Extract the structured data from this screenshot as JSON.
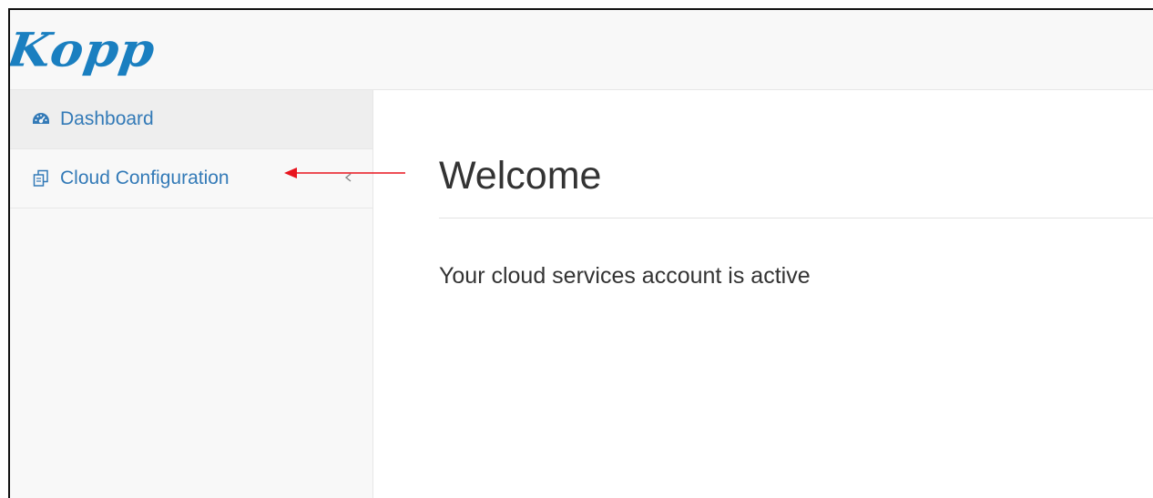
{
  "brand": {
    "logo_text": "Kopp"
  },
  "sidebar": {
    "items": [
      {
        "label": "Dashboard",
        "icon": "dashboard-icon",
        "active": true
      },
      {
        "label": "Cloud Configuration",
        "icon": "copy-icon",
        "expandable": true,
        "chevron_icon": "chevron-left-icon"
      }
    ]
  },
  "main": {
    "title": "Welcome",
    "status": "Your cloud services account is active"
  },
  "annotation": {
    "arrow_icon": "red-arrow-left-icon",
    "color": "#e8141e"
  },
  "colors": {
    "accent": "#1a7fc0",
    "link": "#337ab7",
    "text": "#333333",
    "sidebar_bg": "#f8f8f8"
  }
}
